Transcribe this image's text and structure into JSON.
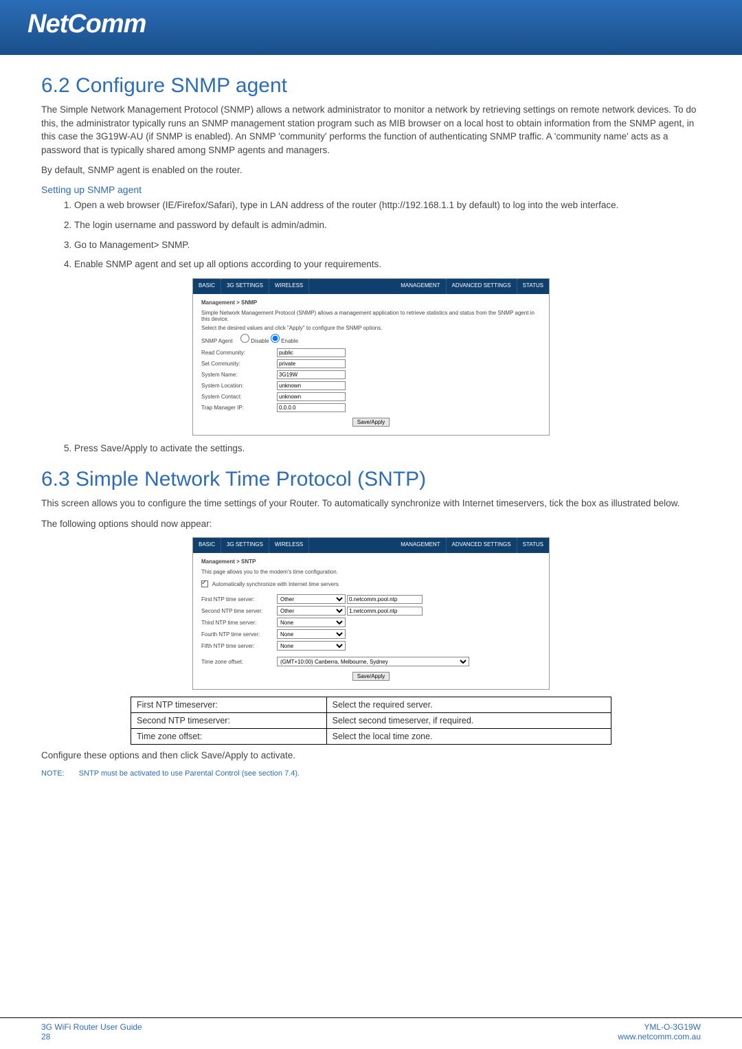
{
  "brand": "NetComm",
  "section62": {
    "heading": "6.2 Configure SNMP agent",
    "p1": "The Simple Network Management Protocol (SNMP) allows a network administrator to monitor a network by retrieving settings on remote network devices. To do this, the administrator typically runs an SNMP management station program such as MIB browser on a local host to obtain information from the SNMP agent, in this case the 3G19W-AU (if SNMP is enabled). An SNMP 'community' performs the function of authenticating SNMP traffic. A 'community name' acts as a password that is typically shared among SNMP agents and managers.",
    "p2": "By default, SNMP agent is enabled on the router.",
    "sub": "Setting up SNMP agent",
    "steps": [
      "Open a web browser (IE/Firefox/Safari), type in LAN address of the router (http://192.168.1.1 by default) to log into the web interface.",
      "The login username and password by default is admin/admin.",
      "Go to Management> SNMP.",
      "Enable SNMP agent and set up all options according to your requirements."
    ],
    "step5": "Press Save/Apply to activate the settings."
  },
  "snmp_shot": {
    "tabs": [
      "BASIC",
      "3G SETTINGS",
      "WIRELESS",
      "MANAGEMENT",
      "ADVANCED SETTINGS",
      "STATUS"
    ],
    "breadcrumb": "Management > SNMP",
    "desc": "Simple Network Management Protocol (SNMP) allows a management application to retrieve statistics and status from the SNMP agent in this device.",
    "desc2": "Select the desired values and click \"Apply\" to configure the SNMP options.",
    "agent_label": "SNMP Agent",
    "disable": "Disable",
    "enable": "Enable",
    "fields": [
      {
        "label": "Read Community:",
        "value": "public"
      },
      {
        "label": "Set Community:",
        "value": "private"
      },
      {
        "label": "System Name:",
        "value": "3G19W"
      },
      {
        "label": "System Location:",
        "value": "unknown"
      },
      {
        "label": "System Contact:",
        "value": "unknown"
      },
      {
        "label": "Trap Manager IP:",
        "value": "0.0.0.0"
      }
    ],
    "save": "Save/Apply"
  },
  "section63": {
    "heading": "6.3 Simple Network Time Protocol (SNTP)",
    "p1": "This screen allows you to configure the time settings of your Router. To automatically synchronize with Internet timeservers, tick the box as illustrated below.",
    "p2": "The following options should now appear:",
    "after": "Configure these options and then click Save/Apply to activate.",
    "note_label": "NOTE:",
    "note_text": "SNTP must be activated to use Parental Control (see section 7.4)."
  },
  "sntp_shot": {
    "tabs": [
      "BASIC",
      "3G SETTINGS",
      "WIRELESS",
      "MANAGEMENT",
      "ADVANCED SETTINGS",
      "STATUS"
    ],
    "breadcrumb": "Management > SNTP",
    "desc": "This page allows you to the modem's time configuration.",
    "autosync": "Automatically synchronize with Internet time servers",
    "rows": [
      {
        "label": "First NTP time server:",
        "sel": "Other",
        "txt": "0.netcomm.pool.ntp"
      },
      {
        "label": "Second NTP time server:",
        "sel": "Other",
        "txt": "1.netcomm.pool.ntp"
      },
      {
        "label": "Third NTP time server:",
        "sel": "None",
        "txt": ""
      },
      {
        "label": "Fourth NTP time server:",
        "sel": "None",
        "txt": ""
      },
      {
        "label": "Fifth NTP time server:",
        "sel": "None",
        "txt": ""
      }
    ],
    "tz_label": "Time zone offset:",
    "tz_value": "(GMT+10:00) Canberra, Melbourne, Sydney",
    "save": "Save/Apply"
  },
  "opt_table": [
    {
      "k": "First NTP timeserver:",
      "v": "Select the required server."
    },
    {
      "k": "Second NTP timeserver:",
      "v": "Select second timeserver, if required."
    },
    {
      "k": "Time zone offset:",
      "v": "Select the local time zone."
    }
  ],
  "footer": {
    "left1": "3G WiFi Router User Guide",
    "left2": "28",
    "right1": "YML-O-3G19W",
    "right2": "www.netcomm.com.au"
  }
}
